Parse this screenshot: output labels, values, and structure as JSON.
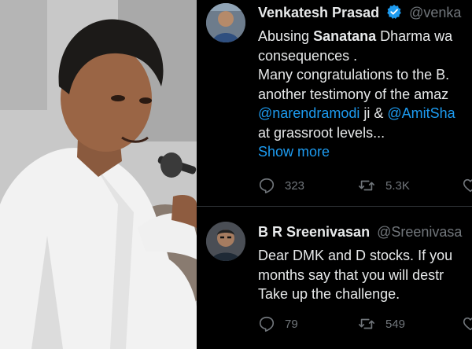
{
  "tweets": [
    {
      "name": "Venkatesh Prasad",
      "handle": "@venka",
      "lines": [
        {
          "parts": [
            {
              "text": "Abusing "
            },
            {
              "text": "Sanatana",
              "bold": true
            },
            {
              "text": " Dharma wa"
            }
          ]
        },
        {
          "parts": [
            {
              "text": "consequences ."
            }
          ]
        },
        {
          "parts": [
            {
              "text": "Many congratulations to the B."
            }
          ]
        },
        {
          "parts": [
            {
              "text": "another testimony of the amaz"
            }
          ]
        },
        {
          "parts": [
            {
              "text": "@narendramodi",
              "mention": true
            },
            {
              "text": " ji & "
            },
            {
              "text": "@AmitSha",
              "mention": true
            }
          ]
        },
        {
          "parts": [
            {
              "text": "at grassroot levels..."
            }
          ]
        }
      ],
      "show_more": "Show more",
      "replies": "323",
      "retweets": "5.3K"
    },
    {
      "name": "B R Sreenivasan",
      "handle": "@Sreenivasa",
      "lines": [
        {
          "parts": [
            {
              "text": "Dear DMK and D stocks. If you"
            }
          ]
        },
        {
          "parts": [
            {
              "text": "months say that you will destr"
            }
          ]
        },
        {
          "parts": [
            {
              "text": "Take up the challenge."
            }
          ]
        }
      ],
      "replies": "79",
      "retweets": "549"
    }
  ],
  "colors": {
    "text": "#e7e9ea",
    "muted": "#71767b",
    "link": "#1d9bf0",
    "verified": "#1d9bf0",
    "divider": "#2f3336"
  },
  "icons": {
    "reply": "reply-icon",
    "retweet": "retweet-icon",
    "like": "heart-icon",
    "verified": "verified-badge-icon"
  }
}
